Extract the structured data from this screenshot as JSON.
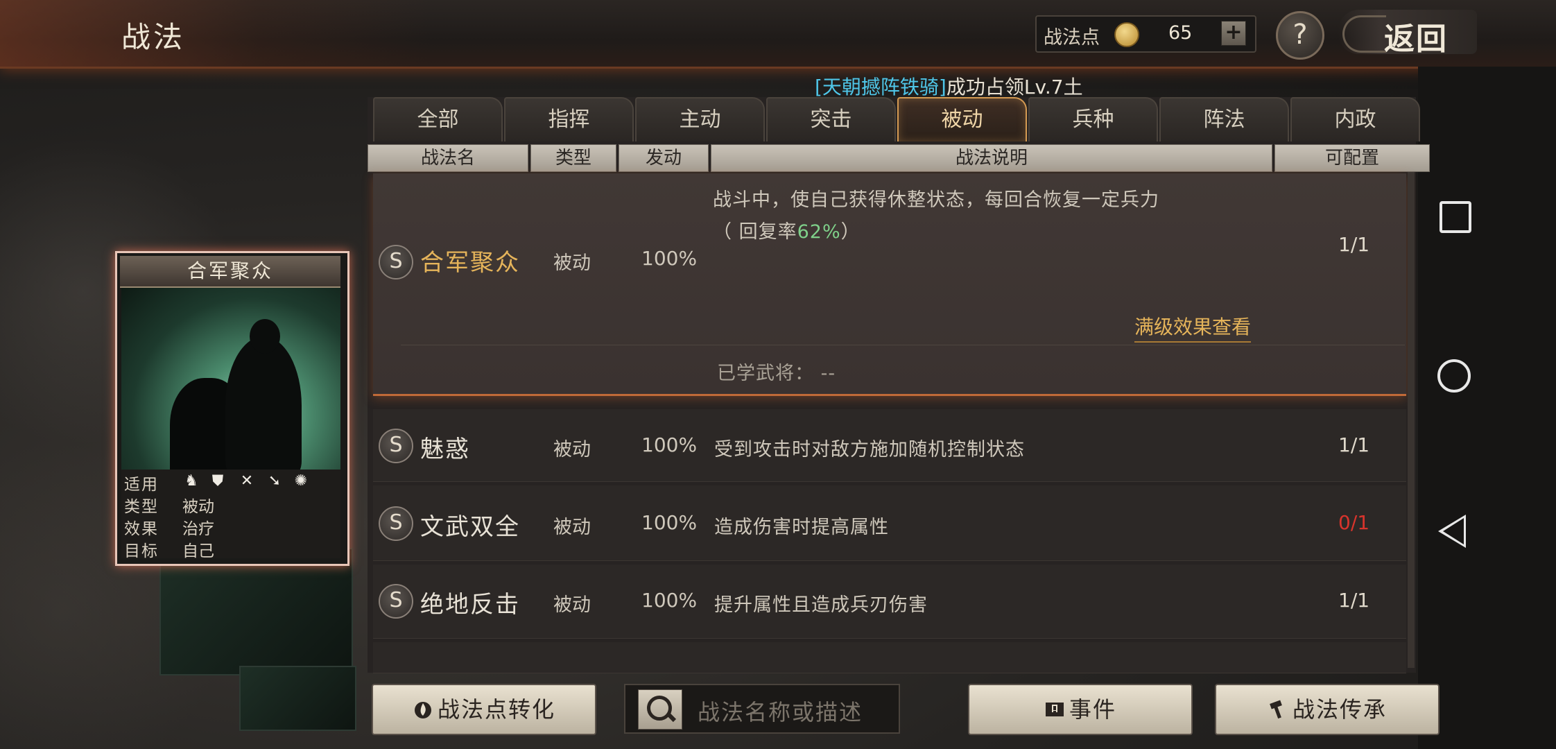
{
  "header": {
    "title": "战法",
    "points_label": "战法点",
    "points_value": "65",
    "plus_label": "+",
    "help_label": "?",
    "back_label": "返回"
  },
  "notice": {
    "highlight": "[天朝撼阵铁骑]",
    "text": "成功占领Lv.7土"
  },
  "tabs": [
    {
      "label": "全部"
    },
    {
      "label": "指挥"
    },
    {
      "label": "主动"
    },
    {
      "label": "突击"
    },
    {
      "label": "被动",
      "active": true
    },
    {
      "label": "兵种"
    },
    {
      "label": "阵法"
    },
    {
      "label": "内政"
    }
  ],
  "columns": {
    "name": "战法名",
    "type": "类型",
    "trigger": "发动",
    "desc": "战法说明",
    "config": "可配置"
  },
  "skills": [
    {
      "icon": "S",
      "name": "合军聚众",
      "type": "被动",
      "rate": "100%",
      "desc_line1": "战斗中，使自己获得休整状态，每回合恢复一定兵力",
      "desc_line2_prefix": "（ 回复率",
      "desc_line2_value": "62%",
      "desc_line2_suffix": "）",
      "config": "1/1",
      "full_level_link": "满级效果查看",
      "learned_label": "已学武将：",
      "learned_value": "--"
    },
    {
      "icon": "S",
      "name": "魅惑",
      "type": "被动",
      "rate": "100%",
      "desc": "受到攻击时对敌方施加随机控制状态",
      "config": "1/1"
    },
    {
      "icon": "S",
      "name": "文武双全",
      "type": "被动",
      "rate": "100%",
      "desc": "造成伤害时提高属性",
      "config": "0/1",
      "config_color": "#d8342c"
    },
    {
      "icon": "S",
      "name": "绝地反击",
      "type": "被动",
      "rate": "100%",
      "desc": "提升属性且造成兵刃伤害",
      "config": "1/1"
    }
  ],
  "card": {
    "title": "合军聚众",
    "rows": [
      {
        "key": "适用",
        "value": ""
      },
      {
        "key": "类型",
        "value": "被动"
      },
      {
        "key": "效果",
        "value": "治疗"
      },
      {
        "key": "目标",
        "value": "自己"
      }
    ],
    "unit_icons": [
      "cavalry-icon",
      "shield-icon",
      "bow-icon",
      "spear-icon",
      "wheel-icon"
    ]
  },
  "bottom": {
    "convert_label": "战法点转化",
    "search_placeholder": "战法名称或描述",
    "event_label": "事件",
    "inherit_label": "战法传承"
  }
}
